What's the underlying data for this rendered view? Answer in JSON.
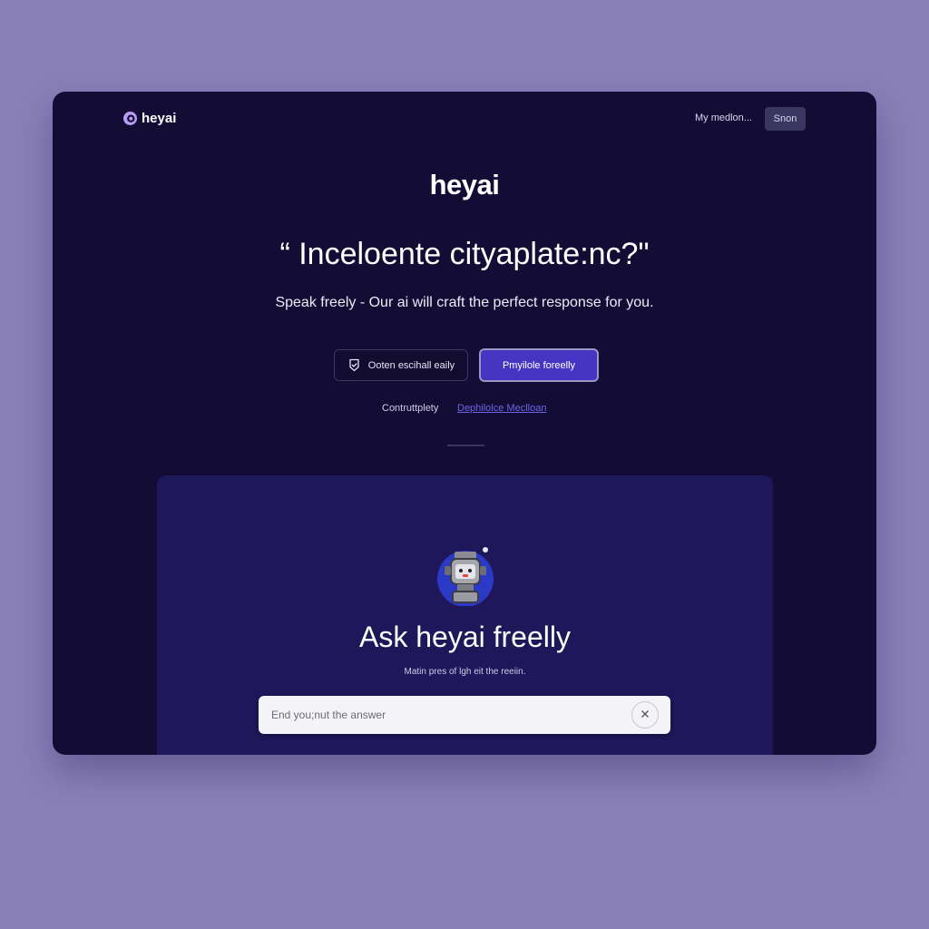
{
  "header": {
    "logo_text": "heyai",
    "nav_link": "My medlon...",
    "signin_label": "Snon"
  },
  "hero": {
    "brand": "heyai",
    "headline": "“ Inceloente cityaplate:nc?\"",
    "subtitle": "Speak freely - Our ai will craft the perfect response for you.",
    "secondary_button": "Ooten escihall eaily",
    "primary_button": "Pmyilole foreelly",
    "meta_text": "Contruttplety",
    "meta_link": "Dephilolce Meclloan"
  },
  "panel": {
    "title": "Ask heyai freelly",
    "subtitle": "Matin pres of lgh eit the reeiin.",
    "search_placeholder": "End you;nut the answer"
  },
  "colors": {
    "page_bg": "#8980b8",
    "window_bg": "#130d35",
    "panel_bg": "#1e175a",
    "accent": "#4635c2",
    "link": "#6f63e6"
  },
  "icons": [
    "heyai-logo-icon",
    "shield-check-icon",
    "robot-avatar-icon",
    "close-icon"
  ]
}
